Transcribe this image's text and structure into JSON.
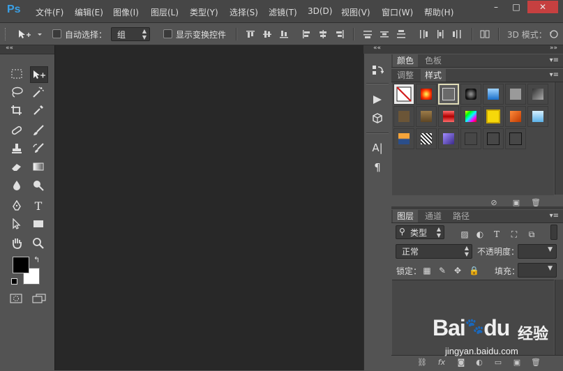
{
  "app": {
    "logo": "Ps"
  },
  "menu": {
    "items": [
      "文件(F)",
      "编辑(E)",
      "图像(I)",
      "图层(L)",
      "类型(Y)",
      "选择(S)",
      "滤镜(T)",
      "3D(D)",
      "视图(V)",
      "窗口(W)",
      "帮助(H)"
    ]
  },
  "window_controls": {
    "minimize": "–",
    "maximize": "□",
    "close": "✕"
  },
  "options_bar": {
    "auto_select_label": "自动选择：",
    "auto_select_checked": false,
    "auto_select_value": "组",
    "show_transform_label": "显示变换控件",
    "show_transform_checked": false,
    "mode_3d_label": "3D 模式："
  },
  "toolbox": {
    "collapse_icon": "double-chevron-left-icon",
    "tools": [
      "rectangular-marquee-icon",
      "move-icon",
      "lasso-icon",
      "magic-wand-icon",
      "crop-icon",
      "eyedropper-icon",
      "spot-healing-brush-icon",
      "brush-icon",
      "clone-stamp-icon",
      "history-brush-icon",
      "eraser-icon",
      "gradient-icon",
      "blur-icon",
      "dodge-icon",
      "pen-icon",
      "type-icon",
      "path-selection-icon",
      "rectangle-shape-icon",
      "hand-icon",
      "zoom-icon"
    ],
    "foreground_color": "#000000",
    "background_color": "#ffffff"
  },
  "middle_dock": {
    "icons": [
      "history-icon",
      "actions-play-icon",
      "properties-3d-icon",
      "character-icon",
      "paragraph-icon"
    ]
  },
  "color_panel": {
    "tabs": [
      "颜色",
      "色板"
    ],
    "active_tab": "颜色"
  },
  "styles_panel": {
    "tabs": [
      "调整",
      "样式"
    ],
    "active_tab": "样式"
  },
  "layers_panel": {
    "tabs": [
      "图层",
      "通道",
      "路径"
    ],
    "active_tab": "图层",
    "filter_label": "类型",
    "blend_mode": "正常",
    "opacity_label": "不透明度：",
    "lock_label": "锁定：",
    "fill_label": "填充："
  },
  "watermark": {
    "brand": "Bai",
    "brand_suffix": "du",
    "tagline": "经验",
    "url": "jingyan.baidu.com"
  },
  "colors": {
    "accent_blue": "#3aa0e6",
    "canvas_bg": "#282828",
    "panel_bg": "#535353",
    "header_bg": "#464646"
  }
}
